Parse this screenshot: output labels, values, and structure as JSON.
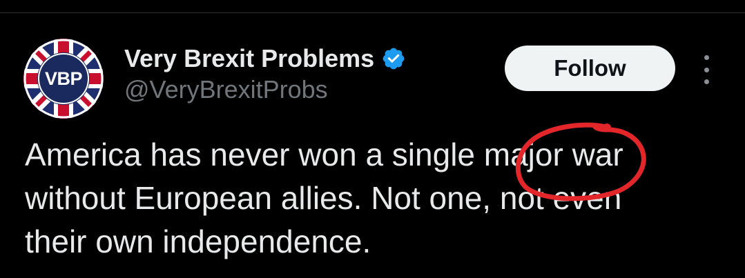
{
  "profile": {
    "display_name": "Very Brexit Problems",
    "handle": "@VeryBrexitProbs",
    "avatar_text": "VBP",
    "verified": true
  },
  "actions": {
    "follow_label": "Follow",
    "more_icon": "more-vertical-icon"
  },
  "tweet": {
    "text": "America has never won a single major war\nwithout European allies. Not one, not even\ntheir own independence."
  },
  "colors": {
    "background": "#000000",
    "text": "#e7e9ea",
    "secondary_text": "#71767b",
    "verified_blue": "#1d9bf0",
    "follow_bg": "#eff3f4",
    "annotation_red": "#e3262a"
  }
}
